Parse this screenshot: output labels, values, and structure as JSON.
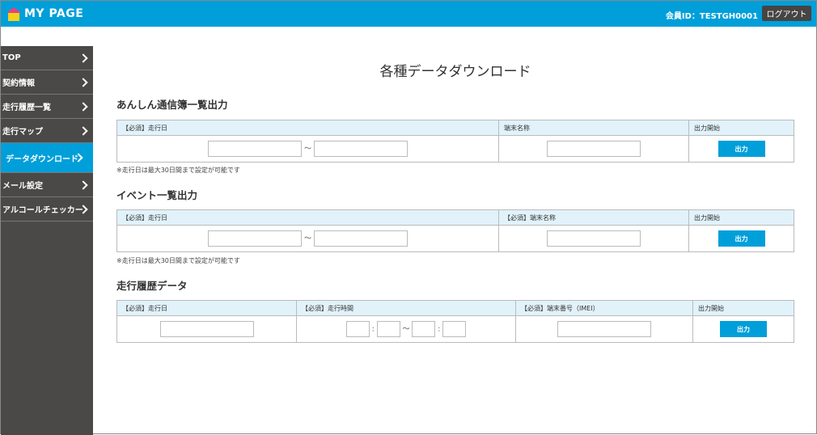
{
  "header": {
    "logo": "MY PAGE",
    "member_id": "会員ID：TESTGH0001",
    "logout": "ログアウト"
  },
  "sidebar": {
    "items": [
      {
        "label": "TOP"
      },
      {
        "label": "契約情報"
      },
      {
        "label": "走行履歴一覧"
      },
      {
        "label": "走行マップ"
      },
      {
        "label": "データダウンロード",
        "active": true
      },
      {
        "label": "メール設定"
      },
      {
        "label": "アルコールチェッカー"
      }
    ]
  },
  "colors": {
    "brand": "#009fd9",
    "sidebar": "#4b4947",
    "table_header": "#e1f2fa"
  },
  "page_title": "各種データダウンロード",
  "sections": [
    {
      "title": "あんしん通信簿一覧出力",
      "cols": [
        "【必須】走行日",
        "端末名称",
        "出力開始"
      ],
      "tilde": "～",
      "button": "出力",
      "note": "※走行日は最大30日間まで設定が可能です"
    },
    {
      "title": "イベント一覧出力",
      "cols": [
        "【必須】走行日",
        "【必須】端末名称",
        "出力開始"
      ],
      "tilde": "～",
      "button": "出力",
      "note": "※走行日は最大30日間まで設定が可能です"
    },
    {
      "title": "走行履歴データ",
      "cols": [
        "【必須】走行日",
        "【必須】走行時間",
        "【必須】端末番号（IMEI）",
        "出力開始"
      ],
      "colon": ":",
      "tilde": "～",
      "button": "出力"
    }
  ]
}
